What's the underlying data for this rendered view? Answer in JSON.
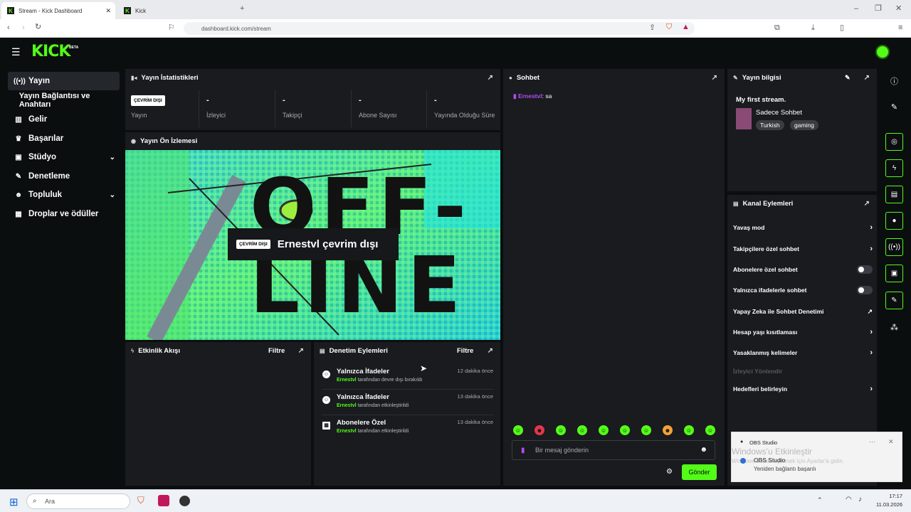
{
  "browser": {
    "tabs": [
      {
        "label": "Stream - Kick Dashboard"
      },
      {
        "label": "Kick"
      }
    ],
    "url": "dashboard.kick.com/stream"
  },
  "app": {
    "logo": "KICK",
    "logo_badge": "BETA"
  },
  "sidebar": {
    "items": [
      {
        "label": "Yayın",
        "icon": "broadcast-icon"
      },
      {
        "label": "Yayın Bağlantısı ve Anahtarı"
      },
      {
        "label": "Gelir",
        "icon": "chart-icon"
      },
      {
        "label": "Başarılar",
        "icon": "trophy-icon"
      },
      {
        "label": "Stüdyo",
        "icon": "studio-icon"
      },
      {
        "label": "Denetleme",
        "icon": "wrench-icon"
      },
      {
        "label": "Topluluk",
        "icon": "people-icon"
      },
      {
        "label": "Droplar ve ödüller",
        "icon": "gift-icon"
      }
    ]
  },
  "stats": {
    "title": "Yayın İstatistikleri",
    "status_badge": "ÇEVRİM DIŞI",
    "cells": [
      {
        "label": "Yayın",
        "value": ""
      },
      {
        "label": "İzleyici",
        "value": "-"
      },
      {
        "label": "Takipçi",
        "value": "-"
      },
      {
        "label": "Abone Sayısı",
        "value": "-"
      },
      {
        "label": "Yayında Olduğu Süre",
        "value": "-"
      }
    ]
  },
  "preview": {
    "title": "Yayın Ön İzlemesi",
    "badge": "ÇEVRİM DIŞI",
    "offline_message": "Ernestvl çevrim dışı",
    "bg_text": "OFF-LINE"
  },
  "activity": {
    "title": "Etkinlik Akışı",
    "filter": "Filtre"
  },
  "moderation": {
    "title": "Denetim Eylemleri",
    "filter": "Filtre",
    "rows": [
      {
        "title": "Yalnızca İfadeler",
        "user": "Ernestvl",
        "action": "tarafından devre dışı bırakıldı",
        "time": "12 dakika önce"
      },
      {
        "title": "Yalnızca İfadeler",
        "user": "Ernestvl",
        "action": "tarafından etkinleştirildi",
        "time": "13 dakika önce"
      },
      {
        "title": "Abonelere Özel",
        "user": "Ernestvl",
        "action": "tarafından etkinleştirildi",
        "time": "13 dakika önce"
      }
    ]
  },
  "chat": {
    "title": "Sohbet",
    "messages": [
      {
        "user": "Ernestvl",
        "text": ": sa"
      }
    ],
    "input_placeholder": "Bir mesaj gönderin",
    "send_label": "Gönder"
  },
  "stream_info": {
    "title": "Yayın bilgisi",
    "stream_title": "My first stream.",
    "category": "Sadece Sohbet",
    "tags": [
      "Turkish",
      "gaming"
    ]
  },
  "channel_actions": {
    "title": "Kanal Eylemleri",
    "rows": [
      {
        "label": "Yavaş mod",
        "control": "arrow"
      },
      {
        "label": "Takipçilere özel sohbet",
        "control": "arrow"
      },
      {
        "label": "Abonelere özel sohbet",
        "control": "toggle",
        "on": false
      },
      {
        "label": "Yalnızca ifadelerle sohbet",
        "control": "toggle",
        "on": false
      },
      {
        "label": "Yapay Zeka ile Sohbet Denetimi",
        "control": "external"
      },
      {
        "label": "Hesap yaşı kısıtlaması",
        "control": "arrow"
      },
      {
        "label": "Yasaklanmış kelimeler",
        "control": "arrow"
      },
      {
        "label": "İzleyici Yönlendir",
        "control": "none",
        "disabled": true
      },
      {
        "label": "Hedefleri belirleyin",
        "control": "arrow"
      }
    ]
  },
  "toast": {
    "app": "OBS Studio",
    "watermark_title": "Windows'u Etkinleştir",
    "watermark_sub": "Windows'u etkinleştirmek için Ayarlar'a gidin.",
    "title": "OBS Studio",
    "message": "Yeniden bağlantı başarılı"
  },
  "taskbar": {
    "search_placeholder": "Ara",
    "time": "17:17",
    "date": "11.03.2026"
  },
  "colors": {
    "accent": "#53fc18",
    "panel": "#191b1f",
    "background": "#0b0e0f"
  }
}
